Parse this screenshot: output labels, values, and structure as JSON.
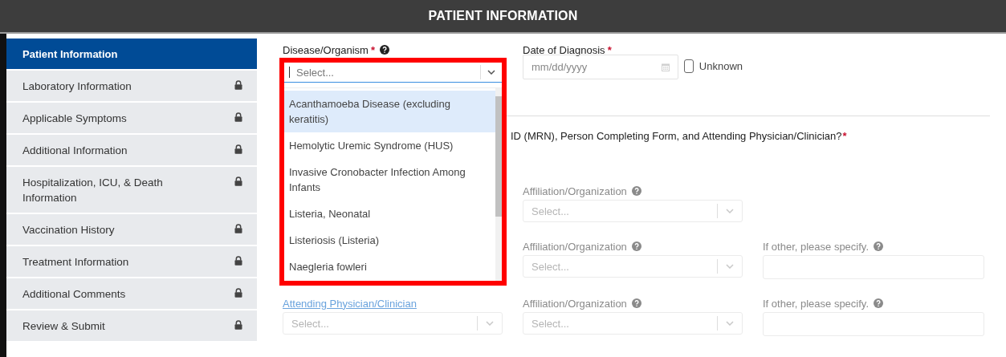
{
  "header": {
    "title": "PATIENT INFORMATION"
  },
  "sidebar": {
    "items": [
      {
        "label": "Patient Information",
        "selected": true,
        "locked": false
      },
      {
        "label": "Laboratory Information",
        "selected": false,
        "locked": true
      },
      {
        "label": "Applicable Symptoms",
        "selected": false,
        "locked": true
      },
      {
        "label": "Additional Information",
        "selected": false,
        "locked": true
      },
      {
        "label": "Hospitalization, ICU, & Death Information",
        "selected": false,
        "locked": true
      },
      {
        "label": "Vaccination History",
        "selected": false,
        "locked": true
      },
      {
        "label": "Treatment Information",
        "selected": false,
        "locked": true
      },
      {
        "label": "Additional Comments",
        "selected": false,
        "locked": true
      },
      {
        "label": "Review & Submit",
        "selected": false,
        "locked": true
      }
    ]
  },
  "disease": {
    "label": "Disease/Organism",
    "required_mark": "*",
    "help": true,
    "placeholder": "Select...",
    "expanded": true,
    "options": [
      {
        "label": "Acanthamoeba Disease (excluding keratitis)",
        "selected": true
      },
      {
        "label": "Hemolytic Uremic Syndrome (HUS)",
        "selected": false
      },
      {
        "label": "Invasive Cronobacter Infection Among Infants",
        "selected": false
      },
      {
        "label": "Listeria, Neonatal",
        "selected": false
      },
      {
        "label": "Listeriosis (Listeria)",
        "selected": false
      },
      {
        "label": "Naegleria fowleri",
        "selected": false
      }
    ]
  },
  "date": {
    "label": "Date of Diagnosis",
    "required_mark": "*",
    "placeholder": "mm/dd/yyyy",
    "unknown": {
      "label": "Unknown",
      "checked": false
    }
  },
  "question": {
    "text": "ID (MRN), Person Completing Form, and Attending Physician/Clinician?",
    "required_mark": "*"
  },
  "rows": [
    {
      "affiliation": {
        "label": "Affiliation/Organization",
        "help": true,
        "placeholder": "Select...",
        "disabled": true
      }
    },
    {
      "affiliation": {
        "label": "Affiliation/Organization",
        "help": true,
        "placeholder": "Select...",
        "disabled": true
      },
      "other": {
        "label": "If other, please specify.",
        "help": true,
        "disabled": true
      }
    },
    {
      "person": {
        "label": "Attending Physician/Clinician",
        "placeholder": "Select...",
        "disabled": true
      },
      "affiliation": {
        "label": "Affiliation/Organization",
        "help": true,
        "placeholder": "Select...",
        "disabled": true
      },
      "other": {
        "label": "If other, please specify.",
        "help": true,
        "disabled": true
      }
    }
  ]
}
